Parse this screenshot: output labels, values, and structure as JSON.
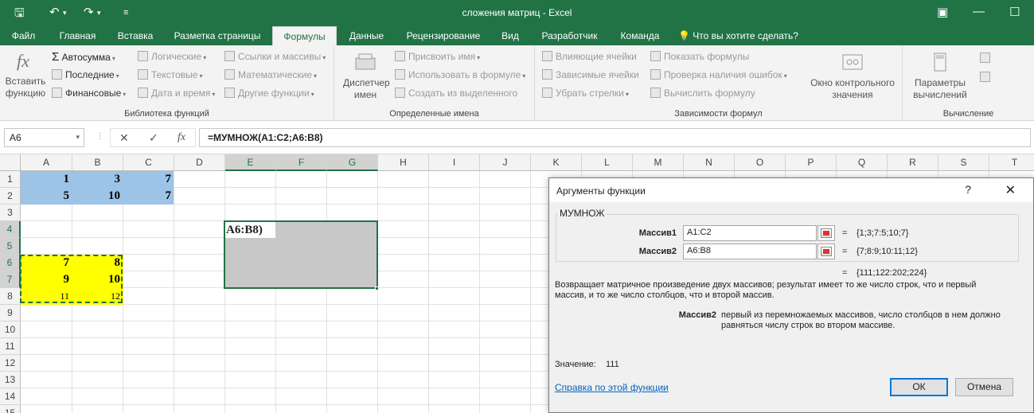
{
  "titlebar": {
    "title": "сложения матриц - Excel"
  },
  "tabs": [
    {
      "label": "Файл"
    },
    {
      "label": "Главная"
    },
    {
      "label": "Вставка"
    },
    {
      "label": "Разметка страницы"
    },
    {
      "label": "Формулы"
    },
    {
      "label": "Данные"
    },
    {
      "label": "Рецензирование"
    },
    {
      "label": "Вид"
    },
    {
      "label": "Разработчик"
    },
    {
      "label": "Команда"
    }
  ],
  "tellme": "Что вы хотите сделать?",
  "ribbon": {
    "library": {
      "insert_function": "Вставить функцию",
      "autosum": "Автосумма",
      "recent": "Последние",
      "financial": "Финансовые",
      "logical": "Логические",
      "text": "Текстовые",
      "datetime": "Дата и время",
      "lookup": "Ссылки и массивы",
      "math": "Математические",
      "other": "Другие функции",
      "label": "Библиотека функций"
    },
    "names": {
      "manager": "Диспетчер имен",
      "define": "Присвоить имя",
      "use_in_formula": "Использовать в формуле",
      "create_from_selection": "Создать из выделенного",
      "label": "Определенные имена"
    },
    "audit": {
      "trace_precedents": "Влияющие ячейки",
      "trace_dependents": "Зависимые ячейки",
      "remove_arrows": "Убрать стрелки",
      "show_formulas": "Показать формулы",
      "error_check": "Проверка наличия ошибок",
      "evaluate": "Вычислить формулу",
      "watch_window": "Окно контрольного значения",
      "label": "Зависимости формул"
    },
    "calc": {
      "options": "Параметры вычислений",
      "label": "Вычисление"
    }
  },
  "formula_bar": {
    "name_box": "A6",
    "formula": "=МУМНОЖ(A1:C2;A6:B8)"
  },
  "columns": [
    "A",
    "B",
    "C",
    "D",
    "E",
    "F",
    "G",
    "H",
    "I",
    "J",
    "K",
    "L",
    "M",
    "N",
    "O",
    "P",
    "Q",
    "R",
    "S",
    "T"
  ],
  "rows": [
    "1",
    "2",
    "3",
    "4",
    "5",
    "6",
    "7",
    "8",
    "9",
    "10",
    "11",
    "12",
    "13",
    "14",
    "15"
  ],
  "cells": {
    "A1": "1",
    "B1": "3",
    "C1": "7",
    "A2": "5",
    "B2": "10",
    "C2": "7",
    "A6": "7",
    "B6": "8",
    "A7": "9",
    "B7": "10",
    "A8": "11",
    "B8": "12",
    "E4": "A6:B8)"
  },
  "dialog": {
    "title": "Аргументы функции",
    "help_q": "?",
    "close": "✕",
    "function_name": "МУМНОЖ",
    "args": [
      {
        "label": "Массив1",
        "value": "A1:C2",
        "result": "{1;3;7:5;10;7}"
      },
      {
        "label": "Массив2",
        "value": "A6:B8",
        "result": "{7;8:9;10:11;12}"
      }
    ],
    "eq": "=",
    "total_result": "{111;122:202;224}",
    "description": "Возвращает матричное произведение двух массивов; результат имеет то же число строк, что и первый массив, и то же число столбцов, что и второй массив.",
    "arg_help_label": "Массив2",
    "arg_help_text": "первый из перемножаемых массивов, число столбцов в нем должно равняться числу строк во втором массиве.",
    "value_label": "Значение:",
    "value": "111",
    "help_link": "Справка по этой функции",
    "ok": "ОК",
    "cancel": "Отмена"
  }
}
